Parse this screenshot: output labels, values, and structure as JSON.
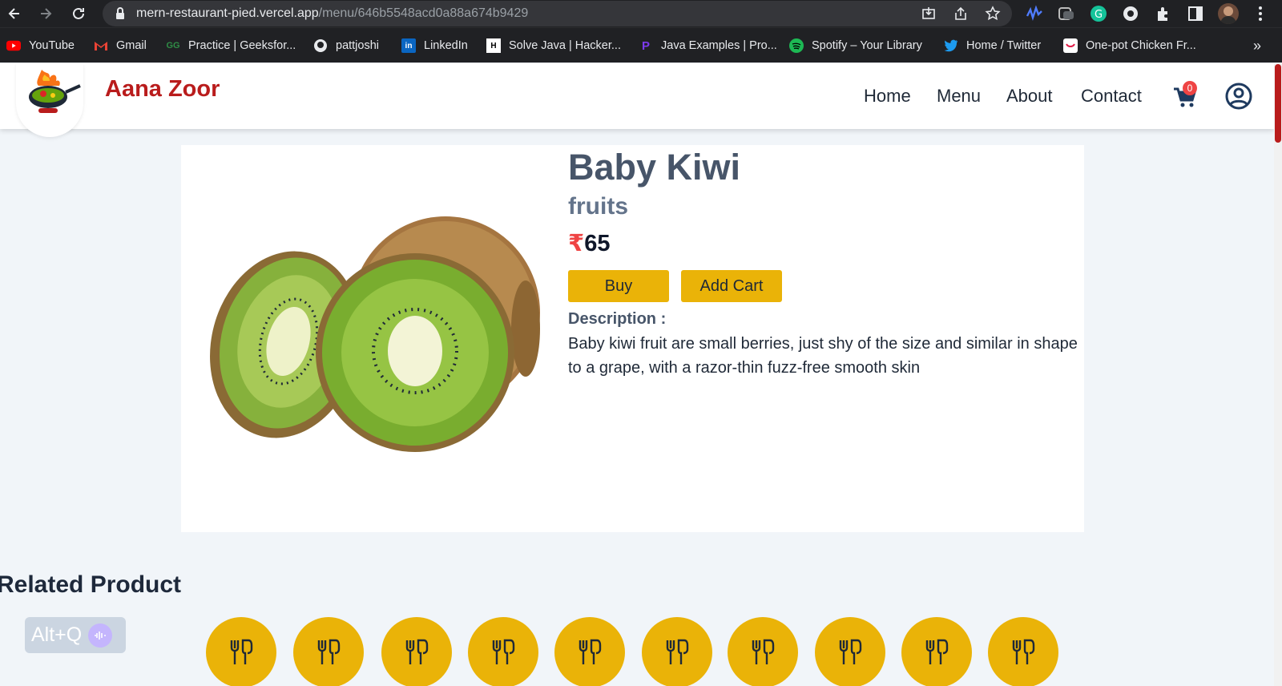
{
  "browser": {
    "url_host": "mern-restaurant-pied.vercel.app",
    "url_path": "/menu/646b5548acd0a88a674b9429",
    "bookmarks": [
      {
        "label": "YouTube",
        "icon": "youtube-icon",
        "color": "#ff0000"
      },
      {
        "label": "Gmail",
        "icon": "gmail-icon",
        "color": "#ea4335"
      },
      {
        "label": "Practice | Geeksfor...",
        "icon": "geeksforgeeks-icon",
        "color": "#2f8d46"
      },
      {
        "label": "pattjoshi",
        "icon": "github-icon",
        "color": "#ffffff"
      },
      {
        "label": "LinkedIn",
        "icon": "linkedin-icon",
        "color": "#0a66c2"
      },
      {
        "label": "Solve Java | Hacker...",
        "icon": "hackerrank-icon",
        "color": "#ffffff"
      },
      {
        "label": "Java Examples | Pro...",
        "icon": "programiz-icon",
        "color": "#7c3aed"
      },
      {
        "label": "Spotify – Your Library",
        "icon": "spotify-icon",
        "color": "#1db954"
      },
      {
        "label": "Home / Twitter",
        "icon": "twitter-icon",
        "color": "#1d9bf0"
      },
      {
        "label": "One-pot Chicken Fr...",
        "icon": "recipe-icon",
        "color": "#e11d48"
      }
    ],
    "more_bookmarks": "»"
  },
  "site": {
    "brand": "Aana Zoor",
    "nav": [
      "Home",
      "Menu",
      "About",
      "Contact"
    ],
    "cart_count": "0"
  },
  "product": {
    "name": "Baby Kiwi",
    "category": "fruits",
    "currency": "₹",
    "price": "65",
    "buy_label": "Buy",
    "add_cart_label": "Add Cart",
    "description_label": "Description :",
    "description": "Baby kiwi fruit are small berries, just shy of the size and similar in shape to a grape, with a razor-thin fuzz-free smooth skin"
  },
  "related": {
    "heading": "Related Product",
    "placeholder_count": 10
  },
  "overlay": {
    "shortcut": "Alt+Q"
  },
  "colors": {
    "brand_red": "#b91c1c",
    "accent_yellow": "#eab308",
    "page_bg": "#f1f5f9"
  }
}
